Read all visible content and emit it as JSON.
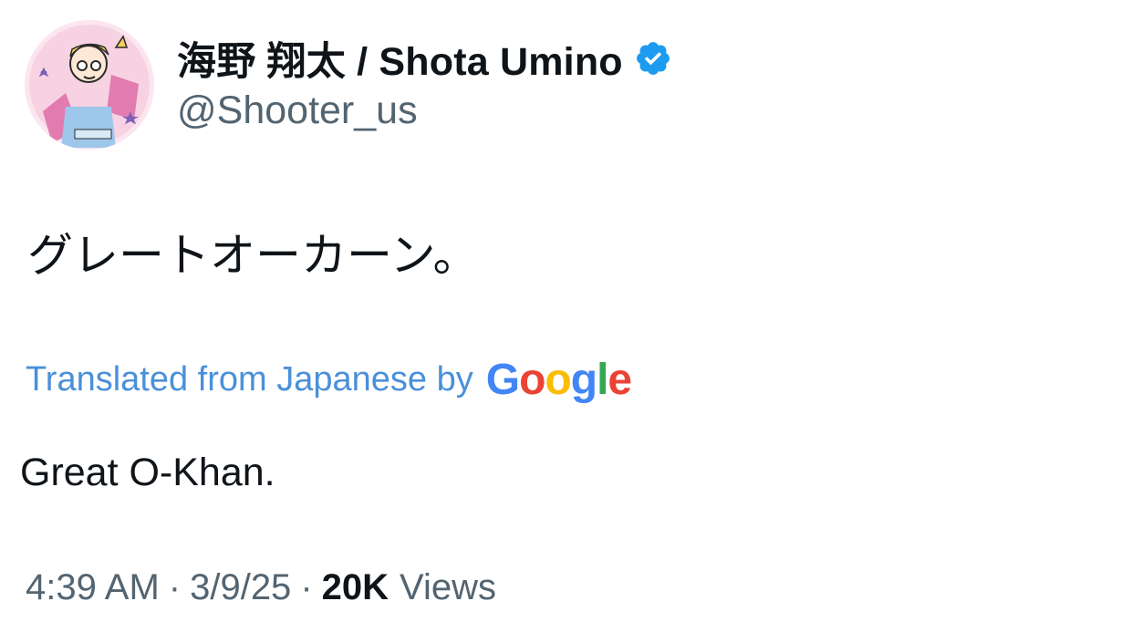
{
  "author": {
    "display_name": "海野 翔太 / Shota Umino",
    "handle": "@Shooter_us",
    "verified": true
  },
  "tweet": {
    "text": "グレートオーカーン。",
    "translation_label": "Translated from Japanese by",
    "translation_provider": "Google",
    "translated_text": "Great O-Khan."
  },
  "meta": {
    "time": "4:39 AM",
    "separator": "·",
    "date": "3/9/25",
    "views_count": "20K",
    "views_label": "Views"
  },
  "colors": {
    "verified_badge": "#1d9bf0",
    "translation_link": "#4a90d9",
    "secondary_text": "#536471"
  },
  "icons": {
    "verified": "verified-badge-icon",
    "avatar": "cartoon-avatar-image"
  }
}
